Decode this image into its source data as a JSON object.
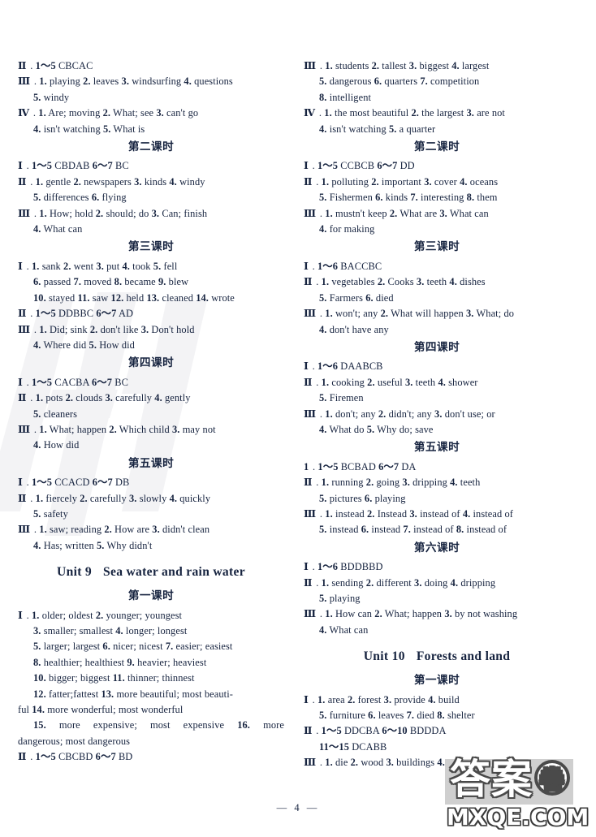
{
  "page": {
    "page_number": "— 4 —",
    "watermark_cjk": "答案",
    "watermark_circled": "卷",
    "watermark_url": "MXQE.COM"
  },
  "left_column": {
    "blocks": [
      {
        "type": "line",
        "marker": "Ⅱ",
        "sep": ".",
        "text": "1～5 CBCAC"
      },
      {
        "type": "line",
        "marker": "Ⅲ",
        "sep": ".",
        "text": "1. playing   2. leaves   3. windsurfing   4. questions"
      },
      {
        "type": "cont",
        "text": "5. windy"
      },
      {
        "type": "line",
        "marker": "Ⅳ",
        "sep": ".",
        "text": "1. Are; moving   2. What; see   3. can't go"
      },
      {
        "type": "cont",
        "text": "4. isn't watching   5. What is"
      },
      {
        "type": "lesson",
        "text": "第二课时"
      },
      {
        "type": "line",
        "marker": "Ⅰ",
        "sep": ".",
        "text": "1～5 CBDAB   6～7 BC"
      },
      {
        "type": "line",
        "marker": "Ⅱ",
        "sep": ".",
        "text": "1. gentle   2. newspapers   3. kinds   4. windy"
      },
      {
        "type": "cont",
        "text": "5. differences   6. flying"
      },
      {
        "type": "line",
        "marker": "Ⅲ",
        "sep": ".",
        "text": "1. How; hold   2. should; do   3. Can; finish"
      },
      {
        "type": "cont",
        "text": "4. What can"
      },
      {
        "type": "lesson",
        "text": "第三课时"
      },
      {
        "type": "line",
        "marker": "Ⅰ",
        "sep": ".",
        "text": "1. sank    2. went    3. put    4. took    5. fell"
      },
      {
        "type": "cont",
        "text": "6. passed   7. moved   8. became   9. blew"
      },
      {
        "type": "cont",
        "text": "10. stayed   11. saw   12. held   13. cleaned   14. wrote"
      },
      {
        "type": "line",
        "marker": "Ⅱ",
        "sep": ".",
        "text": "1～5 DDBBC   6～7 AD"
      },
      {
        "type": "line",
        "marker": "Ⅲ",
        "sep": ".",
        "text": "1. Did; sink   2. don't like   3. Don't hold"
      },
      {
        "type": "cont",
        "text": "4. Where did   5. How did"
      },
      {
        "type": "lesson",
        "text": "第四课时"
      },
      {
        "type": "line",
        "marker": "Ⅰ",
        "sep": ".",
        "text": "1～5 CACBA   6～7 BC"
      },
      {
        "type": "line",
        "marker": "Ⅱ",
        "sep": ".",
        "text": "1. pots   2. clouds   3. carefully   4. gently"
      },
      {
        "type": "cont",
        "text": "5. cleaners"
      },
      {
        "type": "line",
        "marker": "Ⅲ",
        "sep": ".",
        "text": "1. What; happen   2. Which child   3. may not"
      },
      {
        "type": "cont",
        "text": "4. How did"
      },
      {
        "type": "lesson",
        "text": "第五课时"
      },
      {
        "type": "line",
        "marker": "Ⅰ",
        "sep": ".",
        "text": "1～5 CCACD   6～7 DB"
      },
      {
        "type": "line",
        "marker": "Ⅱ",
        "sep": ".",
        "text": "1. fiercely   2. carefully   3. slowly   4. quickly"
      },
      {
        "type": "cont",
        "text": "5. safety"
      },
      {
        "type": "line",
        "marker": "Ⅲ",
        "sep": ".",
        "text": "1. saw; reading   2. How are   3. didn't clean"
      },
      {
        "type": "cont",
        "text": "4. Has; written   5. Why didn't"
      },
      {
        "type": "unit",
        "unit": "Unit 9",
        "title": "Sea water and rain water"
      },
      {
        "type": "lesson",
        "text": "第一课时"
      },
      {
        "type": "line",
        "marker": "Ⅰ",
        "sep": ".",
        "text": "1. older; oldest   2. younger; youngest"
      },
      {
        "type": "cont",
        "text": "3. smaller; smallest   4. longer; longest"
      },
      {
        "type": "cont",
        "text": "5. larger; largest   6. nicer; nicest   7. easier; easiest"
      },
      {
        "type": "cont",
        "text": "8. healthier; healthiest   9. heavier; heaviest"
      },
      {
        "type": "cont",
        "text": "10. bigger; biggest   11. thinner; thinnest"
      },
      {
        "type": "cont",
        "text": "12. fatter;fattest   13. more beautiful; most beauti-"
      },
      {
        "type": "cont0",
        "text": "ful   14. more wonderful; most wonderful"
      },
      {
        "type": "justified",
        "text": "15. more expensive; most expensive   16. more"
      },
      {
        "type": "cont0",
        "text": "dangerous; most dangerous"
      },
      {
        "type": "line",
        "marker": "Ⅱ",
        "sep": ".",
        "text": "1～5 CBCBD   6～7 BD"
      }
    ]
  },
  "right_column": {
    "blocks": [
      {
        "type": "line",
        "marker": "Ⅲ",
        "sep": ".",
        "text": "1. students   2. tallest   3. biggest   4. largest"
      },
      {
        "type": "cont",
        "text": "5. dangerous   6. quarters   7. competition"
      },
      {
        "type": "cont",
        "text": "8. intelligent"
      },
      {
        "type": "line",
        "marker": "Ⅳ",
        "sep": ".",
        "text": "1. the most beautiful   2. the largest   3. are not"
      },
      {
        "type": "cont",
        "text": "4. isn't watching   5. a quarter"
      },
      {
        "type": "lesson",
        "text": "第二课时"
      },
      {
        "type": "line",
        "marker": "Ⅰ",
        "sep": ".",
        "text": "1～5 CCBCB   6～7 DD"
      },
      {
        "type": "line",
        "marker": "Ⅱ",
        "sep": ".",
        "text": "1. polluting   2. important   3. cover   4. oceans"
      },
      {
        "type": "cont",
        "text": "5. Fishermen   6. kinds   7. interesting   8. them"
      },
      {
        "type": "line",
        "marker": "Ⅲ",
        "sep": ".",
        "text": "1. mustn't keep   2. What are   3. What can"
      },
      {
        "type": "cont",
        "text": "4. for making"
      },
      {
        "type": "lesson",
        "text": "第三课时"
      },
      {
        "type": "line",
        "marker": "Ⅰ",
        "sep": ".",
        "text": "1～6 BACCBC"
      },
      {
        "type": "line",
        "marker": "Ⅱ",
        "sep": ".",
        "text": "1. vegetables   2. Cooks   3. teeth   4. dishes"
      },
      {
        "type": "cont",
        "text": "5. Farmers   6. died"
      },
      {
        "type": "line",
        "marker": "Ⅲ",
        "sep": ".",
        "text": "1. won't; any   2. What will happen   3. What; do"
      },
      {
        "type": "cont",
        "text": "4. don't have any"
      },
      {
        "type": "lesson",
        "text": "第四课时"
      },
      {
        "type": "line",
        "marker": "Ⅰ",
        "sep": ".",
        "text": "1～6 DAABCB"
      },
      {
        "type": "line",
        "marker": "Ⅱ",
        "sep": ".",
        "text": "1. cooking   2. useful   3. teeth   4. shower"
      },
      {
        "type": "cont",
        "text": "5. Firemen"
      },
      {
        "type": "line",
        "marker": "Ⅲ",
        "sep": ".",
        "text": "1. don't; any   2. didn't; any   3. don't use; or"
      },
      {
        "type": "cont",
        "text": "4. What do   5. Why do; save"
      },
      {
        "type": "lesson",
        "text": "第五课时"
      },
      {
        "type": "line",
        "marker": "1",
        "sep": ".",
        "text": "1～5 BCBAD   6～7 DA"
      },
      {
        "type": "line",
        "marker": "Ⅱ",
        "sep": ".",
        "text": "1. running   2. going   3. dripping   4. teeth"
      },
      {
        "type": "cont",
        "text": "5. pictures   6. playing"
      },
      {
        "type": "line",
        "marker": "Ⅲ",
        "sep": ".",
        "text": "1. instead   2. Instead   3. instead of   4. instead of"
      },
      {
        "type": "cont",
        "text": "5. instead   6. instead   7. instead of   8. instead of"
      },
      {
        "type": "lesson",
        "text": "第六课时"
      },
      {
        "type": "line",
        "marker": "Ⅰ",
        "sep": ".",
        "text": "1～6 BDDBBD"
      },
      {
        "type": "line",
        "marker": "Ⅱ",
        "sep": ".",
        "text": "1. sending   2. different   3. doing   4. dripping"
      },
      {
        "type": "cont",
        "text": "5. playing"
      },
      {
        "type": "line",
        "marker": "Ⅲ",
        "sep": ".",
        "text": "1. How can   2. What; happen   3. by not washing"
      },
      {
        "type": "cont",
        "text": "4. What can"
      },
      {
        "type": "unit",
        "unit": "Unit 10",
        "title": "Forests and land"
      },
      {
        "type": "lesson",
        "text": "第一课时"
      },
      {
        "type": "line",
        "marker": "Ⅰ",
        "sep": ".",
        "text": "1.  area    2.  forest    3.  provide    4.  build"
      },
      {
        "type": "cont",
        "text": "5. furniture   6. leaves   7. died   8. shelter"
      },
      {
        "type": "line",
        "marker": "Ⅱ",
        "sep": ".",
        "text": "1～5 DDCBA   6～10 BDDDA"
      },
      {
        "type": "cont",
        "text": "11～15 DCABB"
      },
      {
        "type": "line",
        "marker": "Ⅲ",
        "sep": ".",
        "text": "1. die   2. wood   3. buildings   4. nest"
      }
    ]
  }
}
